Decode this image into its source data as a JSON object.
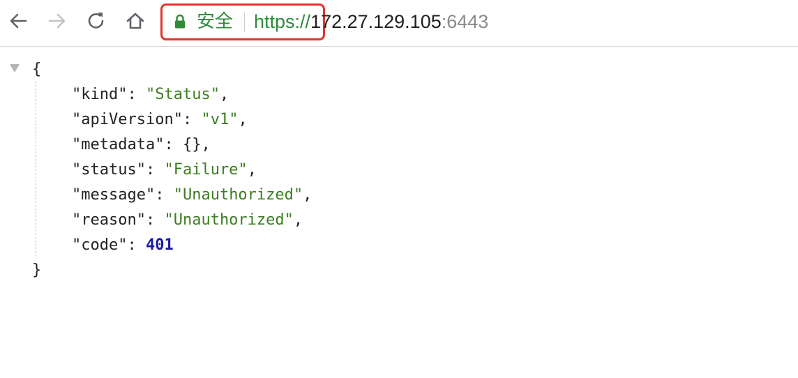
{
  "browser": {
    "security_label": "安全",
    "url": {
      "scheme": "https://",
      "host": "172.27.129.105",
      "port": ":6443"
    },
    "icons": {
      "back": "back-arrow-icon",
      "forward": "forward-arrow-icon",
      "reload": "reload-icon",
      "home": "home-icon",
      "lock": "lock-icon"
    },
    "colors": {
      "secure_green": "#2f8a3b",
      "highlight_red": "#e0352d",
      "json_string": "#3b7d1f",
      "json_number": "#1a1aa6"
    }
  },
  "json_view": {
    "open_brace": "{",
    "close_brace": "}",
    "lines": [
      {
        "key": "\"kind\"",
        "value": "\"Status\"",
        "type": "string",
        "trail": ","
      },
      {
        "key": "\"apiVersion\"",
        "value": "\"v1\"",
        "type": "string",
        "trail": ","
      },
      {
        "key": "\"metadata\"",
        "value": "{}",
        "type": "plain",
        "trail": ","
      },
      {
        "key": "\"status\"",
        "value": "\"Failure\"",
        "type": "string",
        "trail": ","
      },
      {
        "key": "\"message\"",
        "value": "\"Unauthorized\"",
        "type": "string",
        "trail": ","
      },
      {
        "key": "\"reason\"",
        "value": "\"Unauthorized\"",
        "type": "string",
        "trail": ","
      },
      {
        "key": "\"code\"",
        "value": "401",
        "type": "number",
        "trail": ""
      }
    ]
  }
}
